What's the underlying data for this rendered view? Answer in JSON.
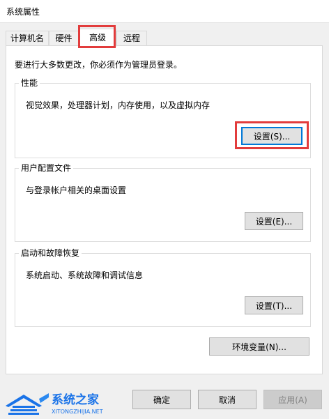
{
  "window": {
    "title": "系统属性"
  },
  "tabs": [
    {
      "label": "计算机名"
    },
    {
      "label": "硬件"
    },
    {
      "label": "高级"
    },
    {
      "label": "远程"
    }
  ],
  "admin_note": "要进行大多数更改，你必须作为管理员登录。",
  "groups": {
    "performance": {
      "title": "性能",
      "description": "视觉效果，处理器计划，内存使用，以及虚拟内存",
      "button": "设置(S)..."
    },
    "user_profiles": {
      "title": "用户配置文件",
      "description": "与登录帐户相关的桌面设置",
      "button": "设置(E)..."
    },
    "startup_recovery": {
      "title": "启动和故障恢复",
      "description": "系统启动、系统故障和调试信息",
      "button": "设置(T)..."
    }
  },
  "env_button": "环境变量(N)...",
  "footer": {
    "ok": "确定",
    "cancel": "取消",
    "apply": "应用(A)"
  },
  "watermark": {
    "name": "系统之家",
    "url": "XITONGZHIJIA.NET"
  },
  "colors": {
    "highlight": "#e23c3c",
    "focus": "#0078d7",
    "watermark_blue": "#1a73e8"
  }
}
